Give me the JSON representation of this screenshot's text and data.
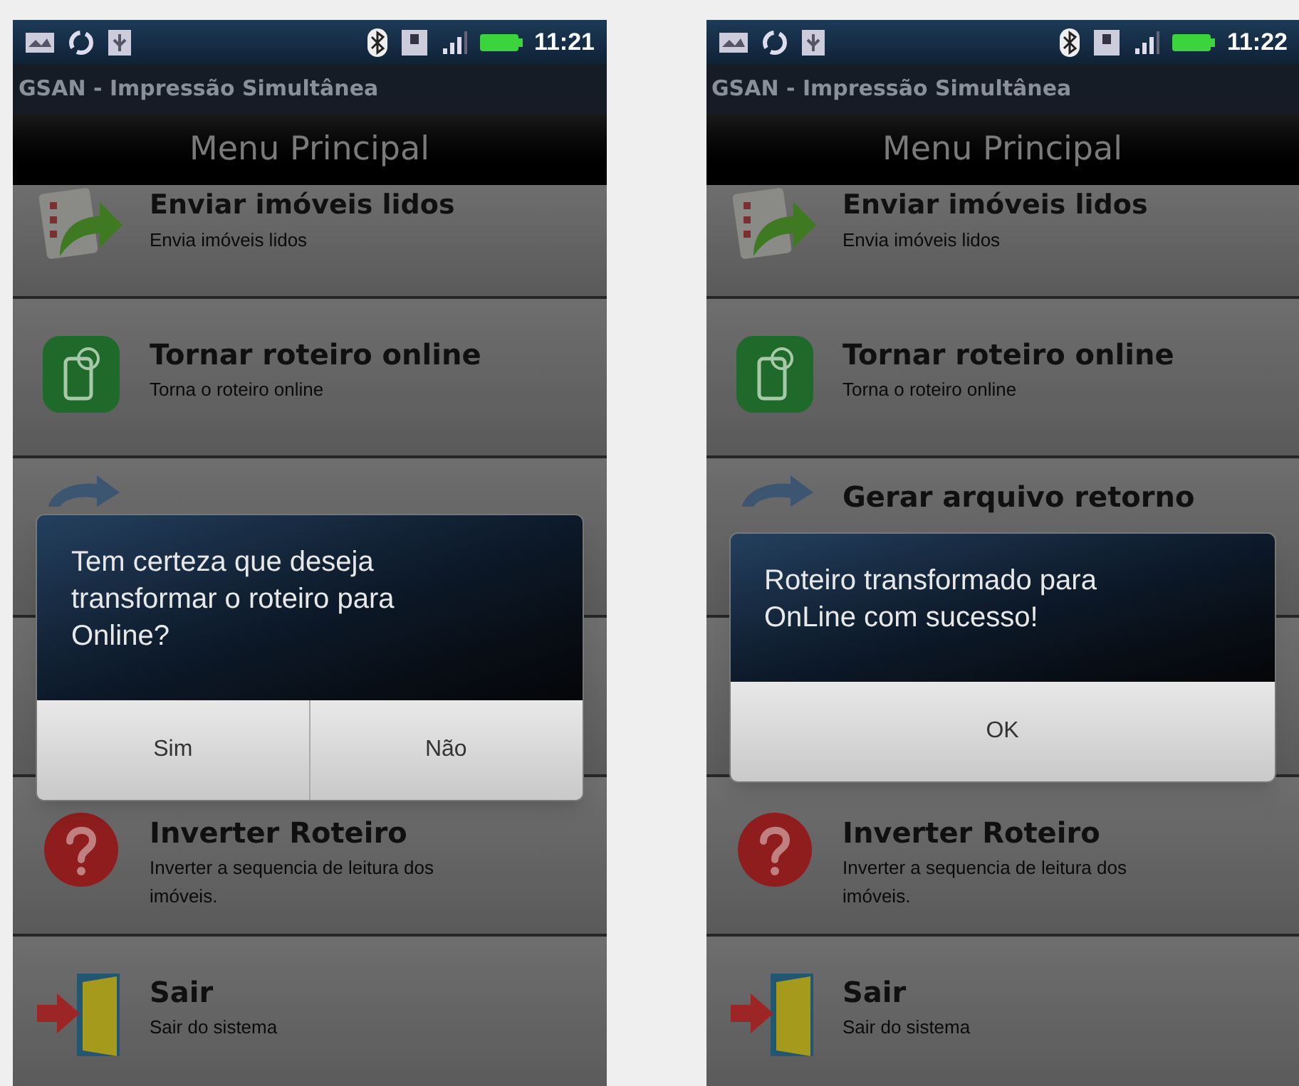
{
  "screens": [
    {
      "status_bar": {
        "time": "11:21"
      },
      "app_title": "GSAN - Impressão Simultânea",
      "header": "Menu Principal",
      "menu_items": [
        {
          "kind": "send",
          "title": "Enviar imóveis lidos",
          "subtitle": "Envia imóveis lidos"
        },
        {
          "kind": "online",
          "title": "Tornar roteiro online",
          "subtitle": "Torna o roteiro online"
        },
        {
          "kind": "archive"
        },
        {
          "kind": "blank"
        },
        {
          "kind": "help",
          "title": "Inverter Roteiro",
          "subtitle": "Inverter a sequencia de leitura dos imóveis."
        },
        {
          "kind": "exit",
          "title": "Sair",
          "subtitle": "Sair do sistema"
        }
      ],
      "dialog": {
        "message": "Tem certeza que deseja transformar o roteiro para Online?",
        "buttons": [
          "Sim",
          "Não"
        ]
      }
    },
    {
      "status_bar": {
        "time": "11:22"
      },
      "app_title": "GSAN - Impressão Simultânea",
      "header": "Menu Principal",
      "menu_items": [
        {
          "kind": "send",
          "title": "Enviar imóveis lidos",
          "subtitle": "Envia imóveis lidos"
        },
        {
          "kind": "online",
          "title": "Tornar roteiro online",
          "subtitle": "Torna o roteiro online"
        },
        {
          "kind": "archive",
          "title": "Gerar arquivo retorno"
        },
        {
          "kind": "blank"
        },
        {
          "kind": "help",
          "title": "Inverter Roteiro",
          "subtitle": "Inverter a sequencia de leitura dos imóveis."
        },
        {
          "kind": "exit",
          "title": "Sair",
          "subtitle": "Sair do sistema"
        }
      ],
      "dialog": {
        "message": "Roteiro transformado para OnLine com sucesso!",
        "buttons": [
          "OK"
        ]
      }
    }
  ]
}
